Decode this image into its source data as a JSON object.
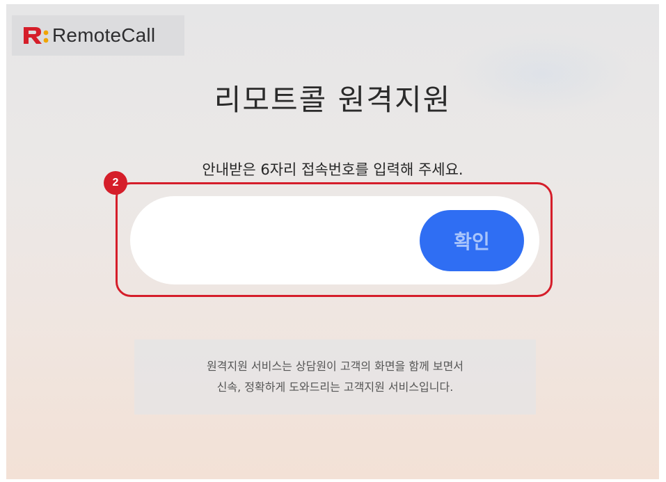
{
  "brand": {
    "name": "RemoteCall",
    "accent_color": "#d51e2a"
  },
  "page": {
    "title": "리모트콜 원격지원",
    "instruction": "안내받은 6자리 접속번호를 입력해 주세요."
  },
  "callout": {
    "number": "2"
  },
  "form": {
    "code_value": "",
    "confirm_label": "확인",
    "button_color": "#2f6ef3"
  },
  "info": {
    "line1": "원격지원 서비스는 상담원이 고객의 화면을 함께 보면서",
    "line2": "신속, 정확하게 도와드리는 고객지원 서비스입니다."
  }
}
